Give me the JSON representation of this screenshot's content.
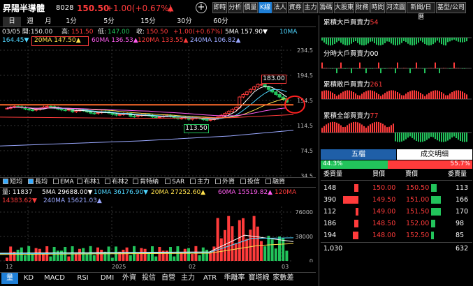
{
  "header": {
    "stock_name": "昇陽半導體",
    "stock_code": "8028",
    "price": "150.50",
    "change": "+1.00(+0.67%)",
    "change_arrow": "▲"
  },
  "toolbar": [
    "即時",
    "分析",
    "價量",
    "K線",
    "法人",
    "資券",
    "主力",
    "籌碼",
    "大股東",
    "財務",
    "時間",
    "河流圖",
    "新聞/日曆",
    "基型/公司"
  ],
  "timeframes": [
    "日",
    "週",
    "月",
    "1分",
    "5分",
    "15分",
    "30分",
    "60分"
  ],
  "ohlc": {
    "date": "03/05 開:150.00",
    "high_label": "高:",
    "high": "151.50",
    "low_label": "低:",
    "low": "147.00",
    "close_label": "收:",
    "close": "150.50",
    "change": "+1.00(+0.67%)",
    "ma5": "5MA 157.90▼",
    "ma10": "10MA",
    "ma10_val": "164.45▼",
    "ma20": "20MA 147.50▲",
    "ma60": "60MA 136.53▲",
    "ma120": "120MA 133.55▲",
    "ma240": "240MA 106.82▲"
  },
  "price_axis": [
    "234.5",
    "194.5",
    "154.5",
    "114.5",
    "74.5",
    "34.5"
  ],
  "price_marks": {
    "high": "183.00",
    "low": "113.50"
  },
  "indicators": [
    {
      "label": "短均",
      "checked": true
    },
    {
      "label": "長均",
      "checked": true
    },
    {
      "label": "EMA",
      "checked": false
    },
    {
      "label": "布林1",
      "checked": false
    },
    {
      "label": "布林2",
      "checked": false
    },
    {
      "label": "肯特納",
      "checked": false
    },
    {
      "label": "SAR",
      "checked": false
    },
    {
      "label": "主力",
      "checked": false
    },
    {
      "label": "外資",
      "checked": false
    },
    {
      "label": "投信",
      "checked": false
    },
    {
      "label": "融資",
      "checked": false
    }
  ],
  "volume_info": {
    "vol": "量: 11837",
    "ma5": "5MA 29688.00▼",
    "ma10": "10MA 36176.90▼",
    "ma20": "20MA 27252.60▲",
    "ma60": "60MA 15519.82▲",
    "ma120": "120MA",
    "ma120_val": "14383.62▼",
    "ma240": "240MA 15621.03▲"
  },
  "volume_axis": [
    "76000",
    "38000",
    "0"
  ],
  "x_axis": [
    "12",
    "2025",
    "02",
    "03"
  ],
  "bottom_tabs": [
    "量",
    "KD",
    "MACD",
    "RSI",
    "DMI",
    "外資",
    "投信",
    "自營",
    "主力",
    "ATR",
    "乖離率",
    "寶塔線",
    "家數差"
  ],
  "right_panels": {
    "p1_title": "累積大戶買賣力",
    "p1_value": "54",
    "p2_title": "分時大戶買賣力",
    "p2_value": "00",
    "p3_title": "累積散戶買賣力",
    "p3_value": "261",
    "p4_title": "累積全部買賣力",
    "p4_value": "77"
  },
  "five_levels": {
    "tab1": "五檔",
    "tab2": "成交明細",
    "buy_pct": "44.3%",
    "sell_pct": "55.7%",
    "buy_ratio": 0.443,
    "headers": [
      "委買量",
      "買價",
      "賣價",
      "委賣量"
    ],
    "rows": [
      {
        "bid_vol": "148",
        "bid": "150.00",
        "ask": "150.50",
        "ask_vol": "113",
        "bid_level": 0.15,
        "ask_level": 0.2
      },
      {
        "bid_vol": "390",
        "bid": "149.50",
        "ask": "151.00",
        "ask_vol": "166",
        "bid_level": 0.55,
        "ask_level": 0.35
      },
      {
        "bid_vol": "112",
        "bid": "149.00",
        "ask": "151.50",
        "ask_vol": "170",
        "bid_level": 0.1,
        "ask_level": 0.35
      },
      {
        "bid_vol": "186",
        "bid": "148.50",
        "ask": "152.00",
        "ask_vol": "98",
        "bid_level": 0.15,
        "ask_level": 0.15
      },
      {
        "bid_vol": "194",
        "bid": "148.00",
        "ask": "152.50",
        "ask_vol": "85",
        "bid_level": 0.2,
        "ask_level": 0.1
      }
    ],
    "total_bid": "1,030",
    "total_ask": "632"
  },
  "colors": {
    "up": "#ff3b3b",
    "down": "#22c35b",
    "accent": "#1f7fd6",
    "ma5": "#ffffff",
    "ma10": "#4fd6ff",
    "ma20": "#ffe14d",
    "ma60": "#ff5cf0",
    "ma120": "#ff3b3b",
    "ma240": "#9aa8ff"
  }
}
